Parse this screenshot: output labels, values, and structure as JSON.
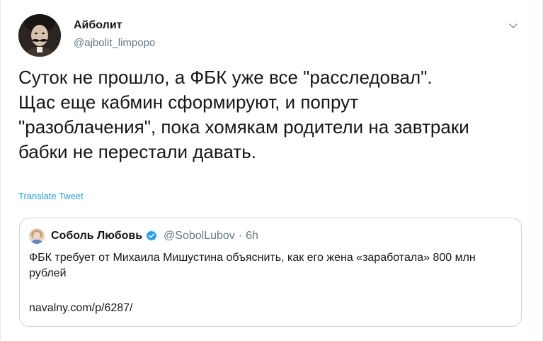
{
  "author": {
    "display_name": "Айболит",
    "username": "@ajbolit_limpopo"
  },
  "tweet": {
    "text": "Суток не прошло, а ФБК уже все \"расследовал\".\nЩас еще кабмин сформируют, и попрут\n\"разоблачения\", пока хомякам родители на завтраки\nбабки не перестали давать.",
    "translate_label": "Translate Tweet"
  },
  "quoted": {
    "display_name": "Соболь Любовь",
    "username": "@SobolLubov",
    "separator": "·",
    "time": "6h",
    "text": "ФБК требует от Михаила Мишустина объяснить, как его жена «заработала» 800 млн рублей",
    "link": "navalny.com/p/6287/"
  },
  "icons": {
    "menu": "chevron-down-icon",
    "verified": "verified-badge-icon"
  },
  "colors": {
    "link_blue": "#1da1f2",
    "secondary_text": "#657786",
    "border": "#ccd6dd"
  }
}
